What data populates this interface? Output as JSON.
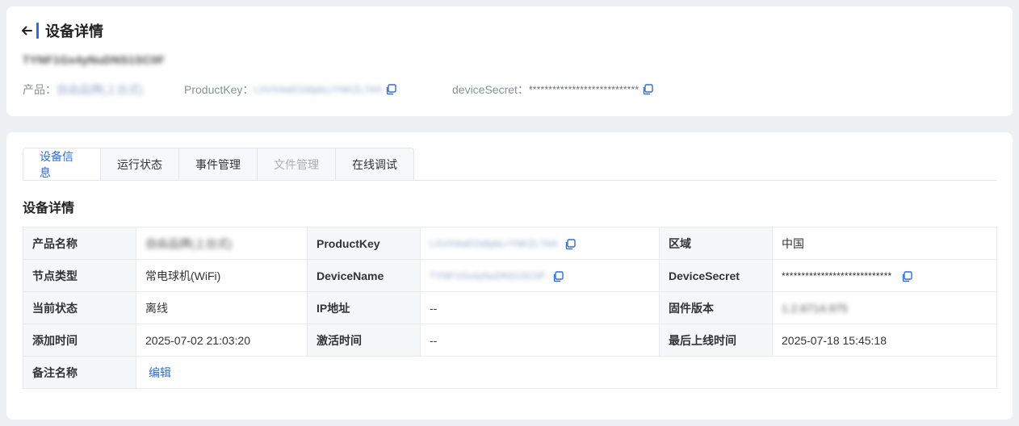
{
  "header": {
    "title": "设备详情",
    "device_name": "TYNF1Gx4yNuDNS1SC0F"
  },
  "meta": {
    "product_label": "产品：",
    "product_value": "自由品牌(上台式)",
    "product_key_label": "ProductKey：",
    "product_key_value": "LXVX4wEOdIpbLrYNKZL7AA",
    "device_secret_label": "deviceSecret：",
    "device_secret_value": "****************************"
  },
  "tabs": [
    {
      "label": "设备信息"
    },
    {
      "label": "运行状态"
    },
    {
      "label": "事件管理"
    },
    {
      "label": "文件管理"
    },
    {
      "label": "在线调试"
    }
  ],
  "section_title": "设备详情",
  "table": {
    "product_name_label": "产品名称",
    "product_name_value": "自由品牌(上台式)",
    "product_key_label": "ProductKey",
    "product_key_value": "LXVX4wEOdIpbLrYNKZL7AA",
    "region_label": "区域",
    "region_value": "中国",
    "node_type_label": "节点类型",
    "node_type_value": "常电球机(WiFi)",
    "device_name_label": "DeviceName",
    "device_name_value": "TYNF1Gx4yNuDNS1SC0F",
    "device_secret_label": "DeviceSecret",
    "device_secret_value": "****************************",
    "status_label": "当前状态",
    "status_value": "离线",
    "ip_label": "IP地址",
    "ip_value": "--",
    "firmware_label": "固件版本",
    "firmware_value": "1.2.6714.975",
    "added_label": "添加时间",
    "added_value": "2025-07-02 21:03:20",
    "activated_label": "激活时间",
    "activated_value": "--",
    "last_online_label": "最后上线时间",
    "last_online_value": "2025-07-18 15:45:18",
    "remark_label": "备注名称",
    "remark_edit": "编辑"
  },
  "colors": {
    "accent": "#2c6ce6",
    "background": "#eef0f3"
  },
  "icons": {
    "back": "arrow-left-icon",
    "copy": "copy-icon"
  }
}
